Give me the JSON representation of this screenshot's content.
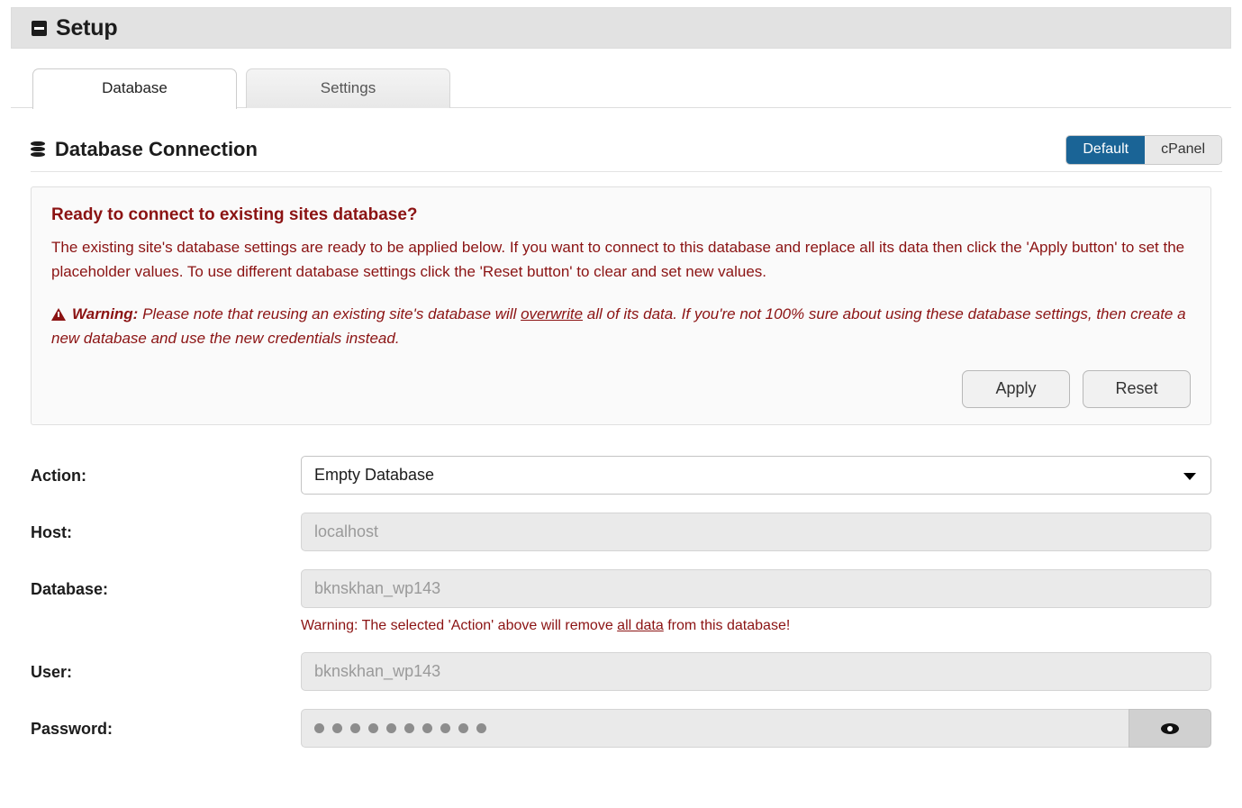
{
  "panel": {
    "title": "Setup",
    "collapse_icon": "minus-square-icon"
  },
  "tabs": [
    {
      "label": "Database",
      "active": true
    },
    {
      "label": "Settings",
      "active": false
    }
  ],
  "section": {
    "icon": "database-icon",
    "title": "Database Connection",
    "toggle": {
      "options": [
        "Default",
        "cPanel"
      ],
      "selected": "Default",
      "active_color": "#1a6496"
    }
  },
  "alert": {
    "accent_color": "#8b1313",
    "heading": "Ready to connect to existing sites database?",
    "body": "The existing site's database settings are ready to be applied below. If you want to connect to this database and replace all its data then click the 'Apply button' to set the placeholder values. To use different database settings click the 'Reset button' to clear and set new values.",
    "warning_icon": "warning-triangle-icon",
    "warning_prefix": "Warning:",
    "warning_part1": " Please note that reusing an existing site's database will ",
    "warning_link": "overwrite",
    "warning_part2": " all of its data. If you're not 100% sure about using these database settings, then create a new database and use the new credentials instead.",
    "apply_label": "Apply",
    "reset_label": "Reset"
  },
  "form": {
    "action": {
      "label": "Action:",
      "value": "Empty Database",
      "caret_icon": "chevron-down-icon"
    },
    "host": {
      "label": "Host:",
      "placeholder": "localhost",
      "value": ""
    },
    "database": {
      "label": "Database:",
      "placeholder": "bknskhan_wp143",
      "value": "",
      "warning_pre": "Warning: The selected 'Action' above will remove ",
      "warning_link": "all data",
      "warning_post": " from this database!"
    },
    "user": {
      "label": "User:",
      "placeholder": "bknskhan_wp143",
      "value": ""
    },
    "password": {
      "label": "Password:",
      "masked_length": 10,
      "toggle_icon": "eye-icon"
    }
  }
}
